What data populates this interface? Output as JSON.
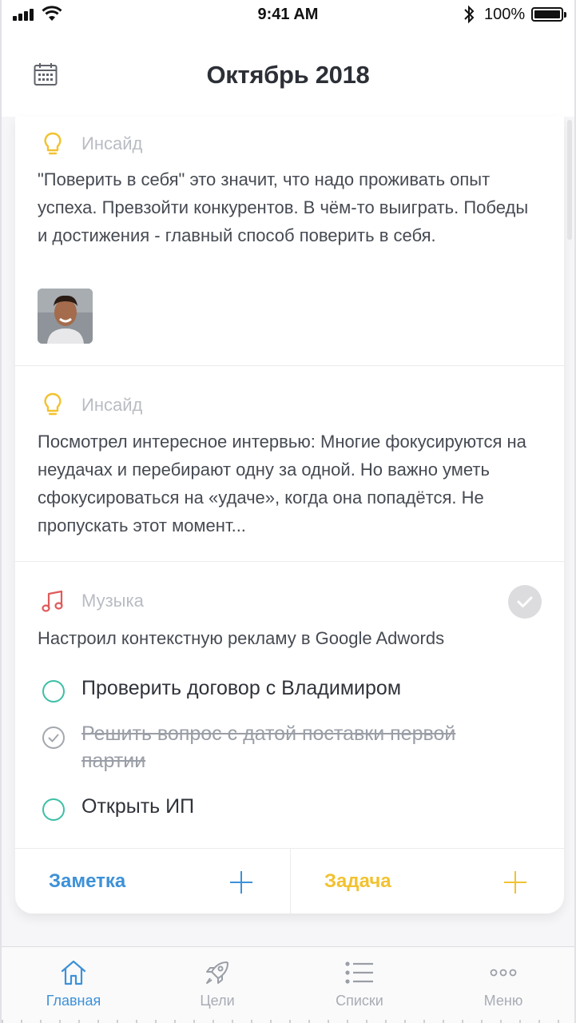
{
  "status_bar": {
    "time": "9:41 AM",
    "battery": "100%"
  },
  "header": {
    "title": "Октябрь 2018",
    "calendar_icon": "calendar-icon"
  },
  "entries": [
    {
      "category": "Инсайд",
      "icon": "lightbulb-icon",
      "text": "\"Поверить в себя\" это значит, что надо проживать опыт успеха. Превзойти конкурентов. В чём-то выиграть. Победы и достижения - главный способ поверить в себя."
    },
    {
      "category": "Инсайд",
      "icon": "lightbulb-icon",
      "text": "Посмотрел интересное интервью: Многие фокусируются на неудачах и перебирают одну за одной. Но важно уметь сфокусироваться на «удаче», когда она попадётся. Не пропускать этот момент..."
    },
    {
      "category": "Музыка",
      "icon": "music-note-icon",
      "text": "Настроил контекстную рекламу в Google Adwords",
      "tasks": [
        {
          "label": "Проверить договор с Владимиром",
          "done": false
        },
        {
          "label": "Решить вопрос с датой поставки первой партии",
          "done": true
        },
        {
          "label": "Открыть ИП",
          "done": false
        }
      ]
    }
  ],
  "footer": {
    "note_label": "Заметка",
    "task_label": "Задача"
  },
  "tabs": [
    {
      "label": "Главная",
      "icon": "home-icon",
      "active": true
    },
    {
      "label": "Цели",
      "icon": "rocket-icon",
      "active": false
    },
    {
      "label": "Списки",
      "icon": "list-icon",
      "active": false
    },
    {
      "label": "Меню",
      "icon": "more-dots-icon",
      "active": false
    }
  ],
  "colors": {
    "accent_blue": "#3d91d8",
    "accent_yellow": "#f2c230",
    "task_teal": "#3cbfa6",
    "music_red": "#e05a5a"
  }
}
